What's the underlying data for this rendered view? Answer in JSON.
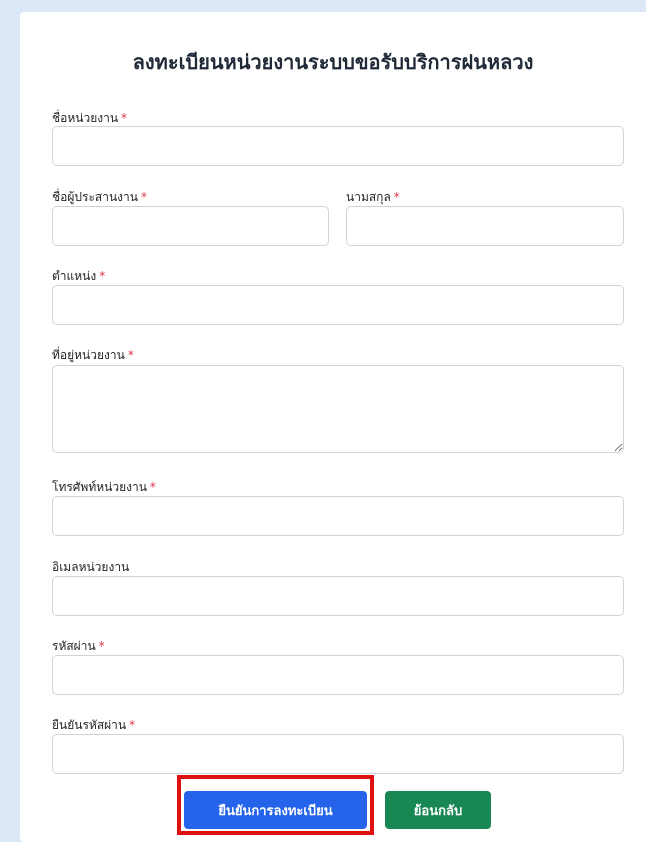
{
  "form": {
    "title": "ลงทะเบียนหน่วยงานระบบขอรับบริการฝนหลวง",
    "required_marker": "*",
    "fields": {
      "org_name": {
        "label": "ชื่อหน่วยงาน",
        "value": "",
        "placeholder": ""
      },
      "coordinator_name": {
        "label": "ชื่อผู้ประสานงาน",
        "value": "",
        "placeholder": ""
      },
      "surname": {
        "label": "นามสกุล",
        "value": "",
        "placeholder": ""
      },
      "position": {
        "label": "ตำแหน่ง",
        "value": "",
        "placeholder": ""
      },
      "address": {
        "label": "ที่อยู่หน่วยงาน",
        "value": "",
        "placeholder": ""
      },
      "phone": {
        "label": "โทรศัพท์หน่วยงาน",
        "value": "",
        "placeholder": ""
      },
      "email": {
        "label": "อิเมลหน่วยงาน",
        "value": "",
        "placeholder": ""
      },
      "password": {
        "label": "รหัสผ่าน",
        "value": "",
        "placeholder": ""
      },
      "confirm_password": {
        "label": "ยืนยันรหัสผ่าน",
        "value": "",
        "placeholder": ""
      }
    },
    "buttons": {
      "submit_label": "ยืนยันการลงทะเบียน",
      "back_label": "ย้อนกลับ"
    }
  },
  "colors": {
    "primary": "#2563eb",
    "success": "#198754",
    "required": "#dc3545",
    "highlight": "#e01010",
    "background": "#dbe7f7"
  }
}
